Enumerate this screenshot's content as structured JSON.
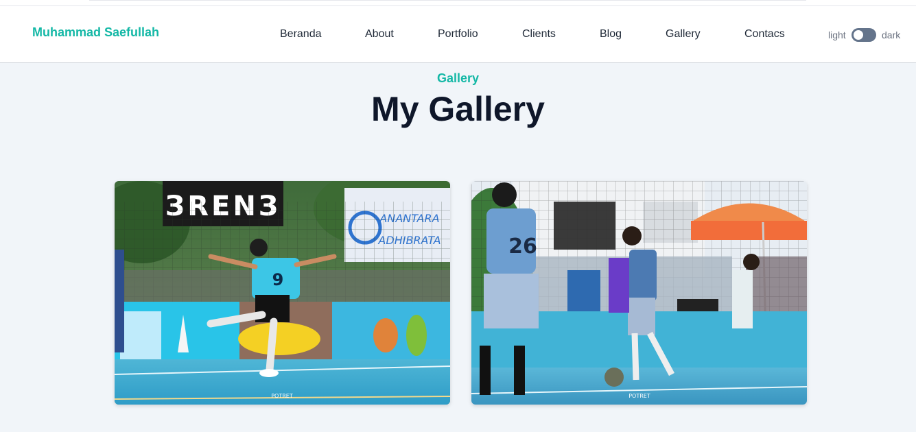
{
  "brand": "Muhammad Saefullah",
  "nav": [
    "Beranda",
    "About",
    "Portfolio",
    "Clients",
    "Blog",
    "Gallery",
    "Contacs"
  ],
  "theme": {
    "light": "light",
    "dark": "dark"
  },
  "section": {
    "label": "Gallery",
    "title": "My Gallery"
  },
  "photos": [
    {
      "icon": "futsal-kick-photo",
      "jersey": "9",
      "banner_text": "ANANTARA ADHIBRATA",
      "watermark": "POTRET"
    },
    {
      "icon": "futsal-dribble-photo",
      "jersey": "26",
      "watermark": "POTRET"
    }
  ],
  "colors": {
    "accent": "#14b8a6",
    "title": "#0f172a",
    "background": "#f1f5f9"
  }
}
